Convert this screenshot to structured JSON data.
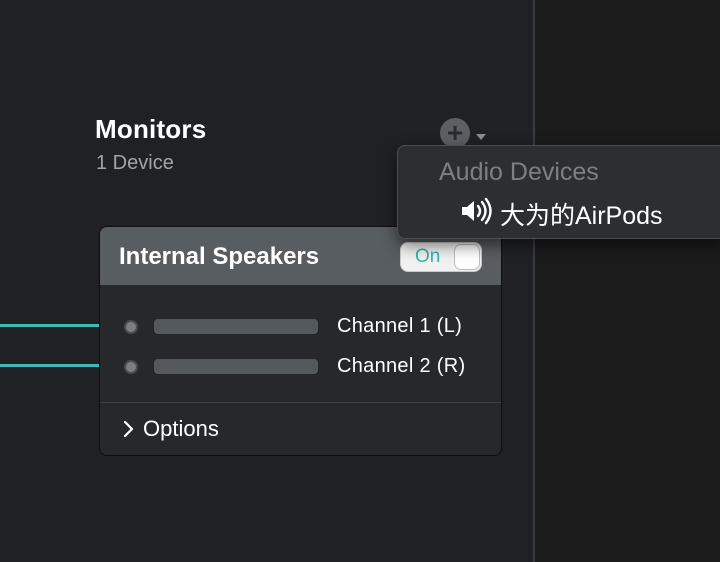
{
  "section": {
    "title": "Monitors",
    "subtitle": "1 Device"
  },
  "add_button": {
    "icon": "plus-circle-icon",
    "symbol": "+"
  },
  "device_card": {
    "name": "Internal Speakers",
    "toggle_label": "On",
    "toggle_state": true,
    "channels": [
      {
        "label": "Channel 1 (L)",
        "connected": true
      },
      {
        "label": "Channel 2 (R)",
        "connected": true
      }
    ],
    "options_label": "Options"
  },
  "popup": {
    "header": "Audio Devices",
    "items": [
      {
        "label": "大为的AirPods",
        "icon": "speaker-icon"
      }
    ]
  },
  "colors": {
    "accent": "#3fb9b4",
    "background": "#1f2124",
    "card_header": "#585d61"
  }
}
